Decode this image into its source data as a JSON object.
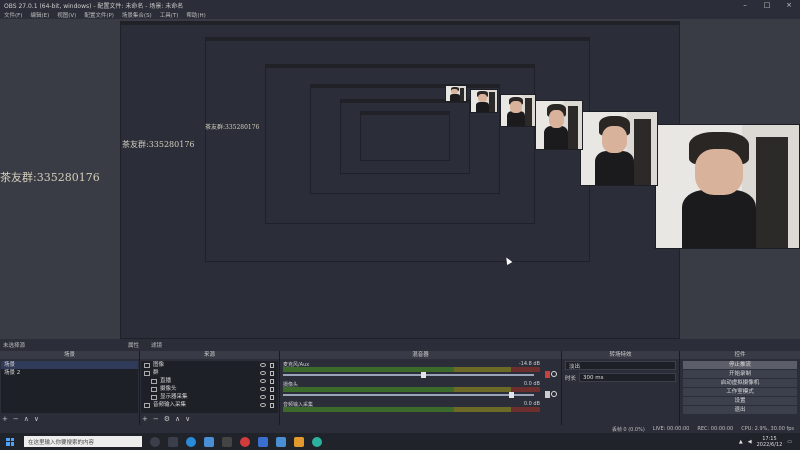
{
  "window": {
    "title": "OBS 27.0.1 (64-bit, windows) - 配置文件: 未命名 - 场景: 未命名"
  },
  "menu": [
    "文件(F)",
    "编辑(E)",
    "视图(V)",
    "配置文件(P)",
    "场景集合(S)",
    "工具(T)",
    "帮助(H)"
  ],
  "watermark": {
    "text": "茶友群:335280176"
  },
  "scene_header": {
    "label": "未选择源",
    "properties": "属性",
    "filters": "滤镜"
  },
  "docks": {
    "scenes": {
      "title": "场景",
      "items": [
        "场景",
        "场景 2"
      ]
    },
    "sources": {
      "title": "来源",
      "items": [
        "图像",
        "群",
        "直播",
        "摄像头",
        "显示器采集",
        "音频输入采集"
      ]
    },
    "mixer": {
      "title": "混音器",
      "channels": [
        {
          "name": "麦克风/Aux",
          "db": "-14.8 dB",
          "level": 0.55
        },
        {
          "name": "摄像头",
          "db": "0.0 dB",
          "level": 0.9
        },
        {
          "name": "音频输入采集",
          "db": "0.0 dB",
          "level": 0.5
        }
      ]
    },
    "transitions": {
      "title": "转场特效",
      "type": "淡出",
      "duration_label": "时长",
      "duration": "300 ms"
    },
    "controls": {
      "title": "控件",
      "buttons": [
        "停止推流",
        "开始录制",
        "启动虚拟摄像机",
        "工作室模式",
        "设置",
        "退出"
      ]
    }
  },
  "status": {
    "live": "LIVE: 00:00:00",
    "rec": "REC: 00:00:00",
    "cpu": "CPU: 2.9%, 30.00 fps",
    "dropped": "丢帧 0 (0.0%)"
  },
  "taskbar": {
    "search_placeholder": "在这里输入你要搜索的内容",
    "time": "17:15",
    "date": "2022/6/12"
  },
  "colors": {
    "meter_green": "#3b6a2a",
    "meter_yellow": "#6d6a28",
    "meter_red": "#6d2e2e",
    "accent": "#4aa3ff"
  }
}
